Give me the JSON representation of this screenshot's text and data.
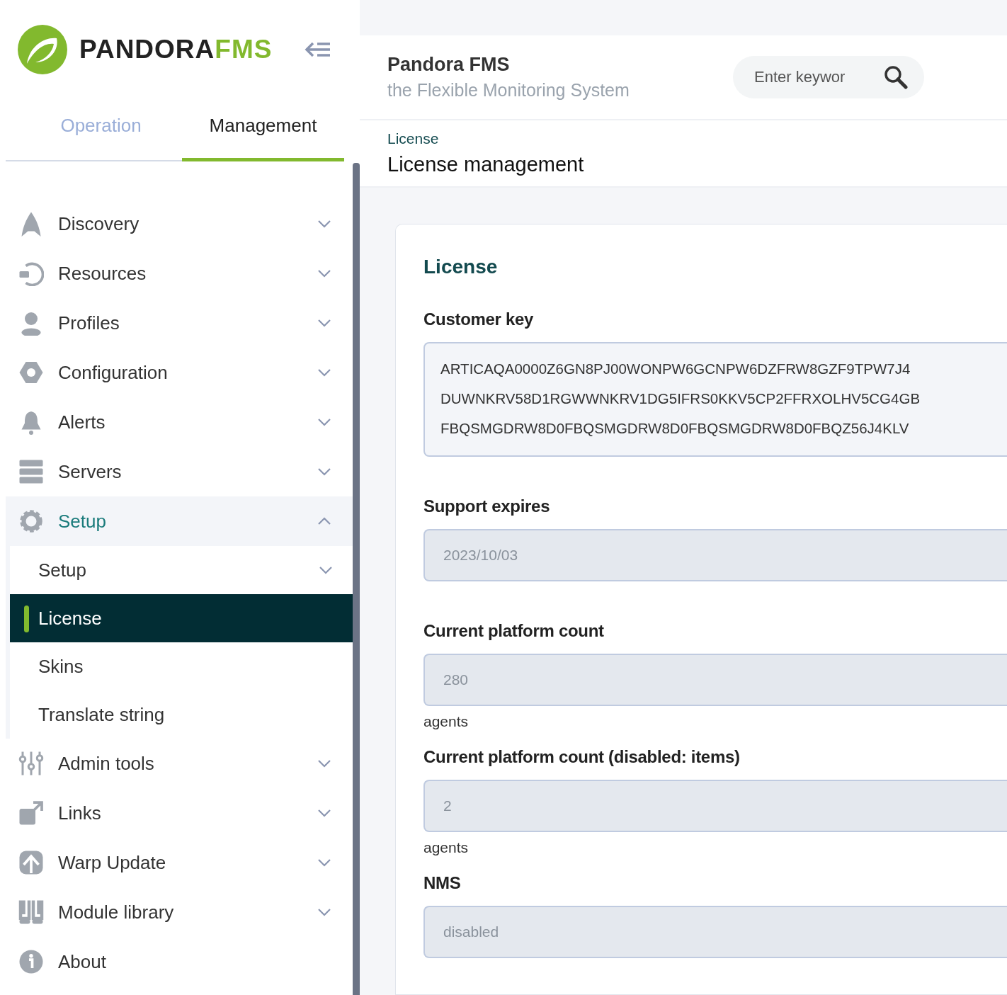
{
  "logo": {
    "text_dark": "PANDORA",
    "text_accent": "FMS"
  },
  "tabs": [
    {
      "label": "Operation",
      "selected": false
    },
    {
      "label": "Management",
      "selected": true
    }
  ],
  "menu": [
    {
      "label": "Discovery",
      "kind": "group",
      "expanded": false,
      "selected": false
    },
    {
      "label": "Resources",
      "kind": "group",
      "expanded": false,
      "selected": false
    },
    {
      "label": "Profiles",
      "kind": "group",
      "expanded": false,
      "selected": false
    },
    {
      "label": "Configuration",
      "kind": "group",
      "expanded": false,
      "selected": false
    },
    {
      "label": "Alerts",
      "kind": "group",
      "expanded": false,
      "selected": false
    },
    {
      "label": "Servers",
      "kind": "group",
      "expanded": false,
      "selected": false
    },
    {
      "label": "Setup",
      "kind": "group",
      "expanded": true,
      "selected": true,
      "children": [
        {
          "label": "Setup",
          "kind": "group",
          "expanded": false,
          "selected": false
        },
        {
          "label": "License",
          "kind": "link",
          "selected": true
        },
        {
          "label": "Skins",
          "kind": "link",
          "selected": false
        },
        {
          "label": "Translate string",
          "kind": "link",
          "selected": false
        }
      ]
    },
    {
      "label": "Admin tools",
      "kind": "group",
      "expanded": false,
      "selected": false
    },
    {
      "label": "Links",
      "kind": "group",
      "expanded": false,
      "selected": false
    },
    {
      "label": "Warp Update",
      "kind": "group",
      "expanded": false,
      "selected": false
    },
    {
      "label": "Module library",
      "kind": "group",
      "expanded": false,
      "selected": false
    },
    {
      "label": "About",
      "kind": "link",
      "selected": false
    }
  ],
  "header": {
    "title": "Pandora FMS",
    "subtitle": "the Flexible Monitoring System",
    "search": {
      "placeholder": "Enter keywor"
    }
  },
  "breadcrumb": "License",
  "page_title": "License management",
  "card": {
    "title": "License",
    "fields": [
      {
        "label": "Customer key",
        "kind": "textarea",
        "disabled": false,
        "lines": [
          "ARTICAQA0000Z6GN8PJ00WONPW6GCNPW6DZFRW8GZF9TPW7J4",
          "DUWNKRV58D1RGWWNKRV1DG5IFRS0KKV5CP2FFRXOLHV5CG4GB",
          "FBQSMGDRW8D0FBQSMGDRW8D0FBQSMGDRW8D0FBQZ56J4KLV"
        ]
      },
      {
        "label": "Support expires",
        "kind": "input",
        "disabled": true,
        "value": "2023/10/03"
      },
      {
        "label": "Current platform count",
        "kind": "input",
        "disabled": true,
        "value": "280",
        "unit": "agents"
      },
      {
        "label": "Current platform count (disabled: items)",
        "kind": "input",
        "disabled": true,
        "value": "2",
        "unit": "agents"
      },
      {
        "label": "NMS",
        "kind": "input",
        "disabled": true,
        "value": "disabled"
      }
    ]
  }
}
